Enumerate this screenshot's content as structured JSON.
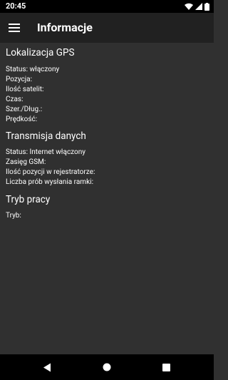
{
  "status_bar": {
    "time": "20:45",
    "icons": [
      "wifi-icon",
      "cell-signal-icon",
      "battery-icon"
    ]
  },
  "app_bar": {
    "menu_icon": "menu-icon",
    "title": "Informacje"
  },
  "sections": [
    {
      "title": "Lokalizacja GPS",
      "rows": [
        "Status: włączony",
        "Pozycja:",
        "Ilość satelit:",
        "Czas:",
        "Szer./Dług.:",
        "Prędkość:"
      ]
    },
    {
      "title": "Transmisja danych",
      "rows": [
        "Status: Internet włączony",
        "Zasięg GSM:",
        "Ilość pozycji w rejestratorze:",
        "Liczba prób wysłania ramki:"
      ]
    },
    {
      "title": "Tryb pracy",
      "rows": [
        "Tryb:"
      ]
    }
  ],
  "nav_bar": {
    "buttons": [
      "back-icon",
      "home-icon",
      "recents-icon"
    ]
  },
  "colors": {
    "background": "#303030",
    "app_bar": "#212121",
    "status_bar": "#000000",
    "text": "#ffffff"
  }
}
